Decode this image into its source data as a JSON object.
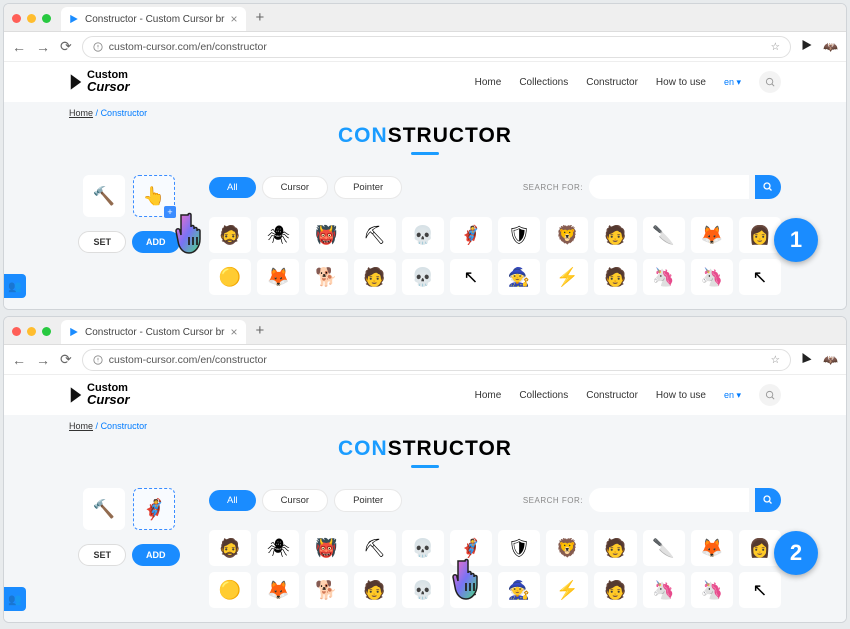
{
  "tab": {
    "title": "Constructor - Custom Cursor br"
  },
  "url": "custom-cursor.com/en/constructor",
  "logo": {
    "line1": "Custom",
    "line2": "Cursor"
  },
  "nav": {
    "home": "Home",
    "collections": "Collections",
    "constructor": "Constructor",
    "howto": "How to use",
    "lang": "en"
  },
  "breadcrumb": {
    "home": "Home",
    "sep": "/",
    "current": "Constructor"
  },
  "title": {
    "part1": "CON",
    "part2": "STRUCTOR"
  },
  "filters": {
    "all": "All",
    "cursor": "Cursor",
    "pointer": "Pointer"
  },
  "search": {
    "label": "SEARCH FOR:"
  },
  "buttons": {
    "set": "SET",
    "add": "ADD",
    "plus": "+"
  },
  "steps": {
    "one": "1",
    "two": "2"
  },
  "grid_items": [
    "🧔",
    "🕷",
    "👹",
    "⛏",
    "💀",
    "🦸",
    "🛡",
    "🦁",
    "🧑",
    "🔪",
    "🦊",
    "👩",
    "🟡",
    "🦊",
    "🐕",
    "🧑",
    "💀",
    "↖",
    "🧙",
    "⚡",
    "🧑",
    "🦄",
    "🦄",
    "↖"
  ],
  "icons": {
    "hammer": "🔨",
    "captain": "🦸"
  }
}
